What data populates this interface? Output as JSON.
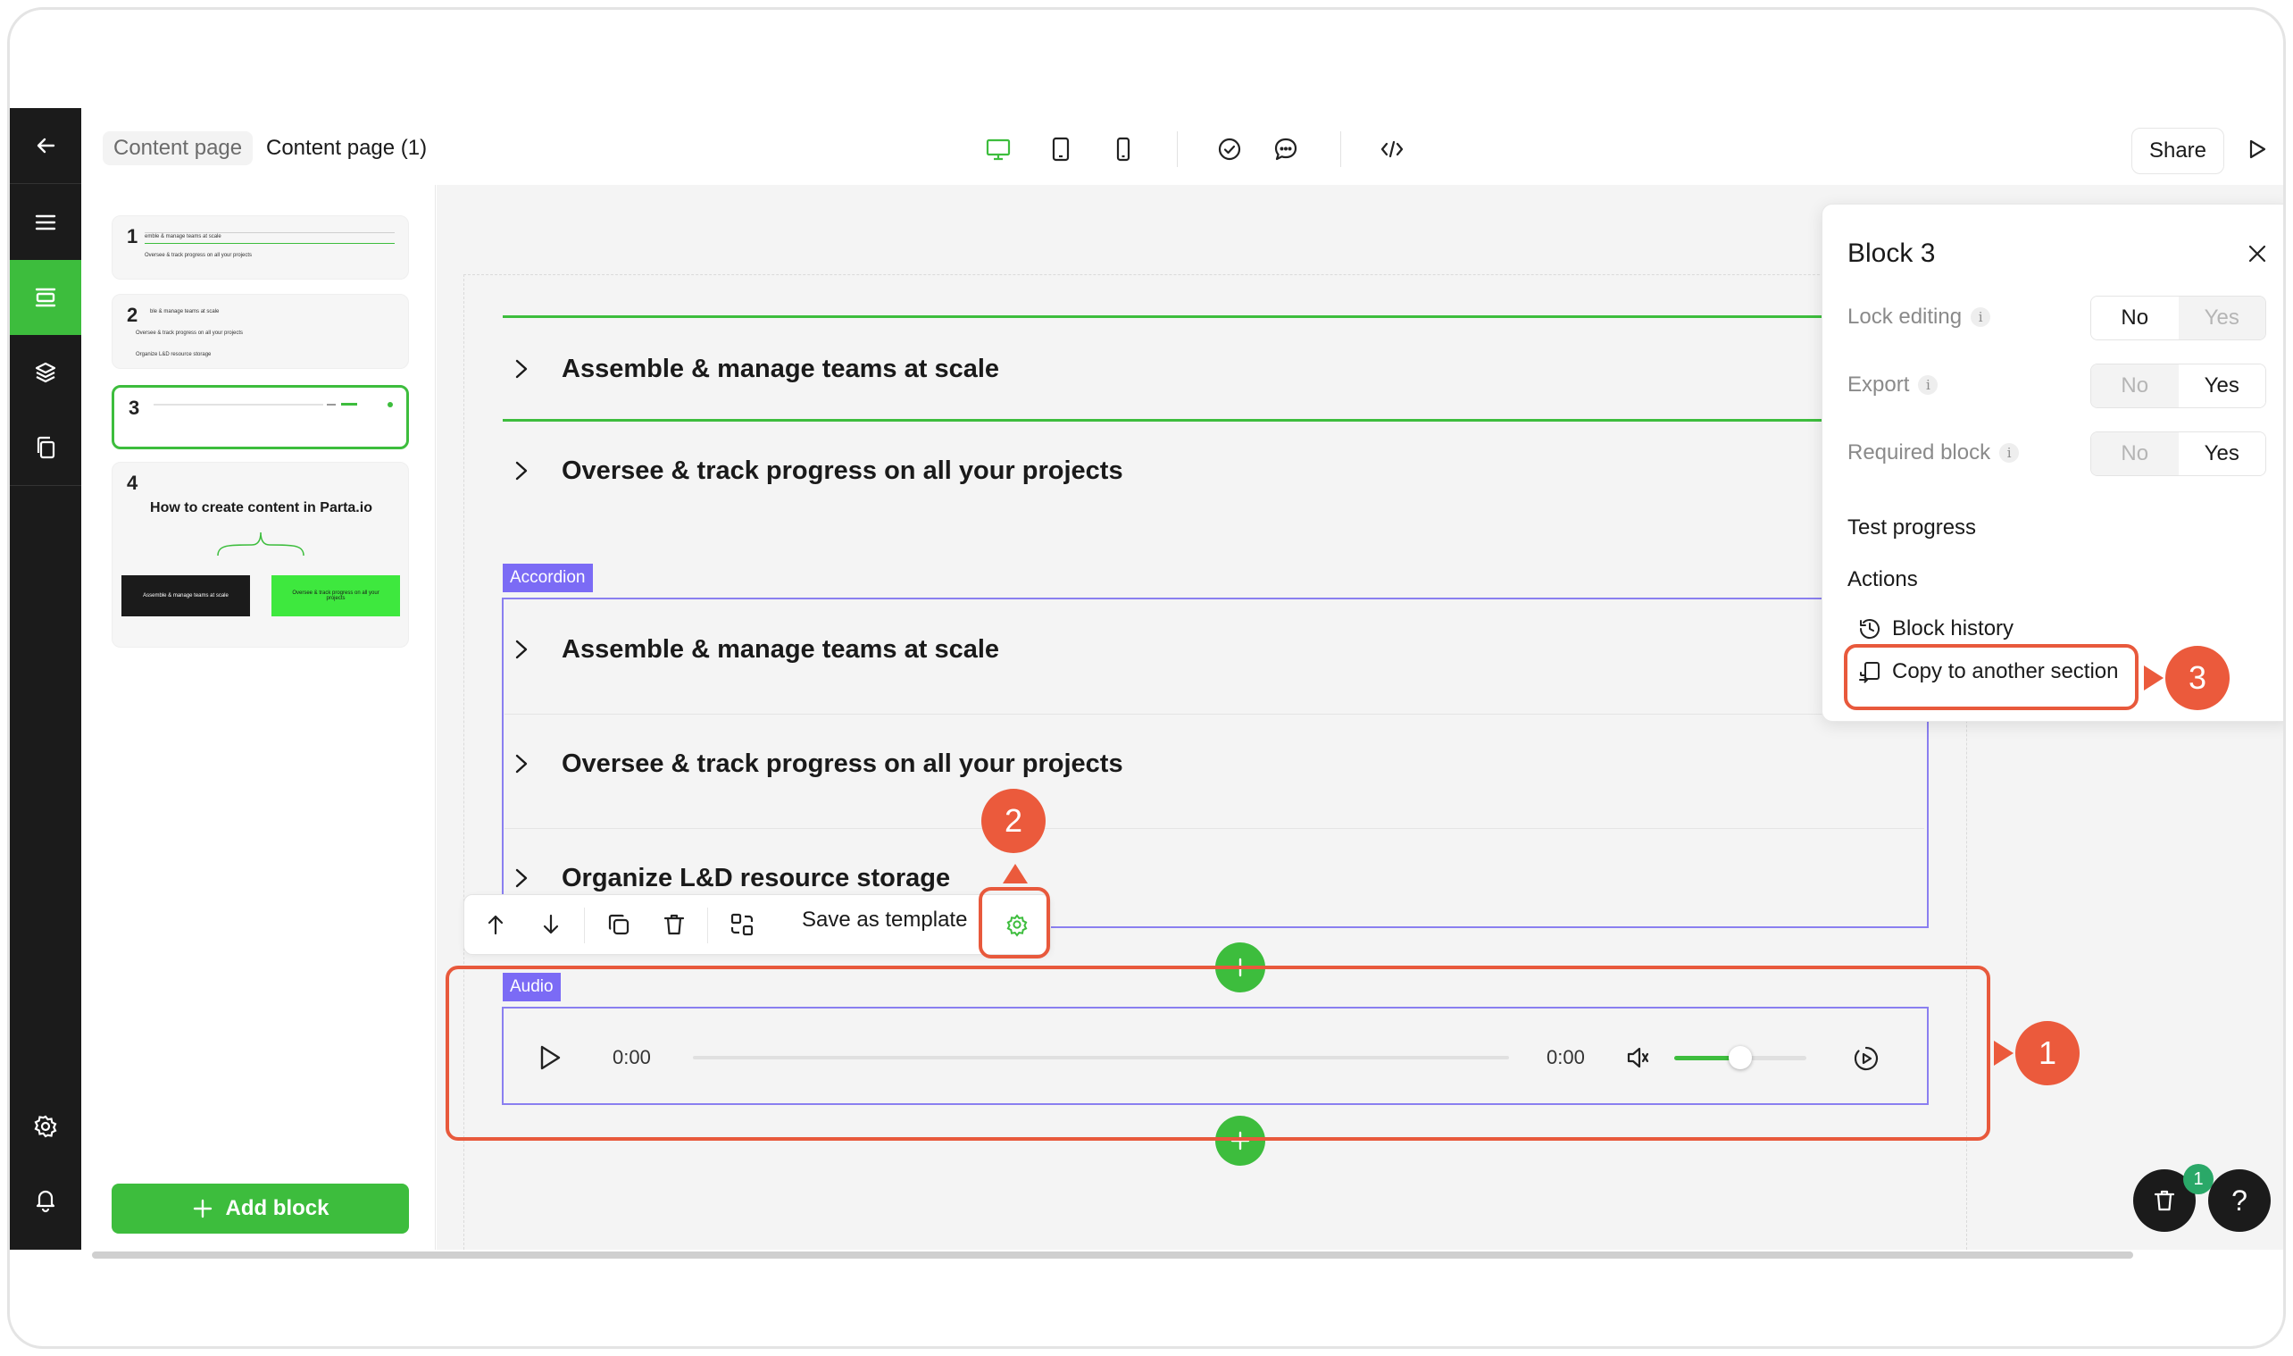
{
  "breadcrumb": {
    "parent": "Content page",
    "current": "Content page (1)"
  },
  "topbar": {
    "share_label": "Share"
  },
  "blocks_panel": {
    "thumbs": [
      {
        "num": "1",
        "lines": [
          "emble & manage teams at scale",
          "Oversee & track progress on all your projects"
        ]
      },
      {
        "num": "2",
        "lines": [
          "ble & manage teams at scale",
          "Oversee & track progress on all your projects",
          "Organize L&D resource storage"
        ]
      },
      {
        "num": "3"
      },
      {
        "num": "4",
        "title": "How to create content in Parta.io",
        "card_left": "Assemble & manage teams at scale",
        "card_right": "Oversee & track progress on all your projects"
      }
    ],
    "add_block_label": "Add block"
  },
  "canvas": {
    "block2_rows": [
      "Assemble & manage teams at scale",
      "Oversee & track progress on all your projects"
    ],
    "accordion_tag": "Accordion",
    "accordion_rows": [
      "Assemble & manage teams at scale",
      "Oversee & track progress on all your projects",
      "Organize L&D resource storage"
    ],
    "toolbar": {
      "save_template_label": "Save as template"
    },
    "audio_tag": "Audio",
    "audio": {
      "current_time": "0:00",
      "duration": "0:00",
      "volume": 0.5
    }
  },
  "popover": {
    "title": "Block 3",
    "settings": [
      {
        "label": "Lock editing",
        "info": "i",
        "no": "No",
        "yes": "Yes",
        "selected": "No"
      },
      {
        "label": "Export",
        "info": "i",
        "no": "No",
        "yes": "Yes",
        "selected": "Yes"
      },
      {
        "label": "Required block",
        "info": "i",
        "no": "No",
        "yes": "Yes",
        "selected": "Yes"
      }
    ],
    "test_progress": "Test progress",
    "actions_heading": "Actions",
    "block_history": "Block history",
    "copy_to_section": "Copy to another section"
  },
  "callouts": [
    "1",
    "2",
    "3"
  ],
  "notifications_count": "1",
  "help_glyph": "?",
  "colors": {
    "accent": "#3dbd3d",
    "callout": "#eb5a3c",
    "selection": "#8a7ff0"
  }
}
